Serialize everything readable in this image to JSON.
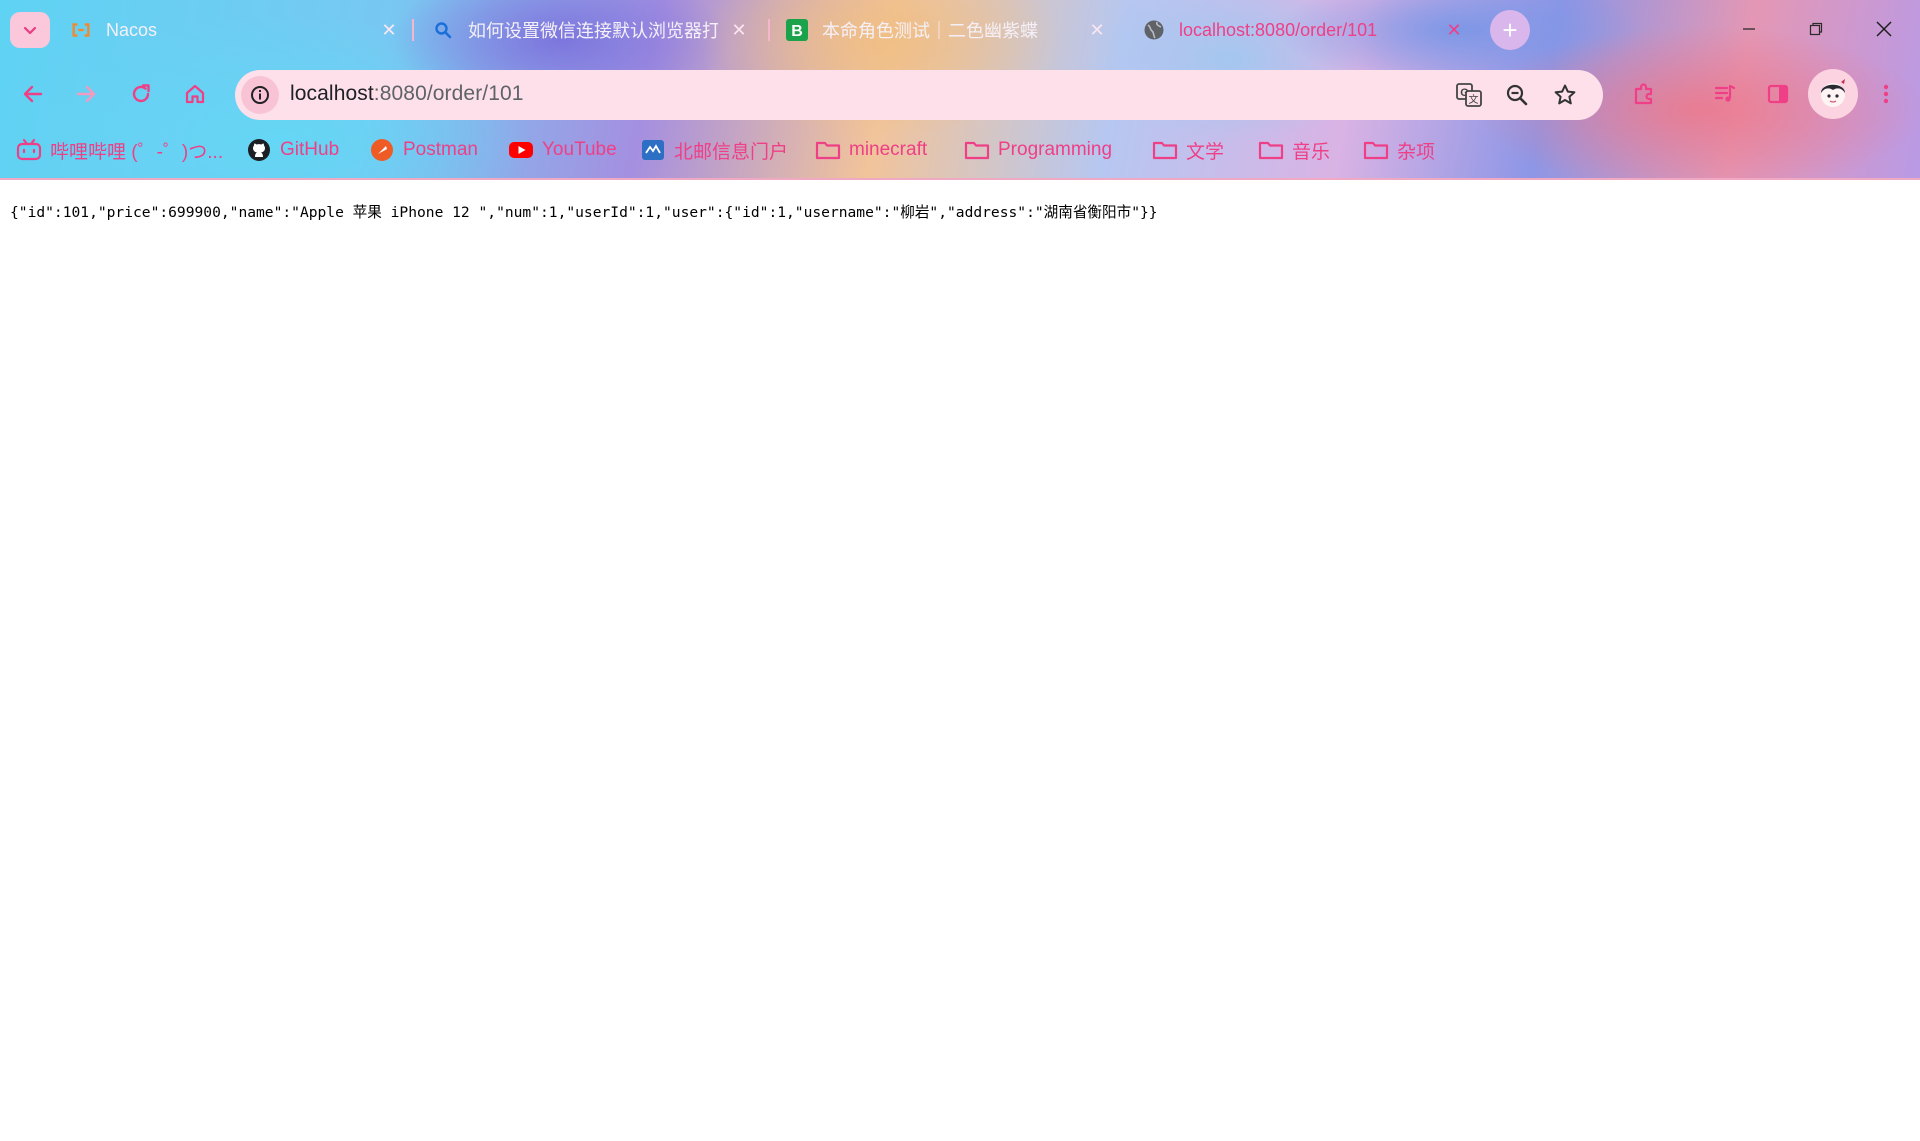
{
  "tabs": [
    {
      "title": "Nacos",
      "favicon": "nacos-icon",
      "active": false
    },
    {
      "title": "如何设置微信连接默认浏览器打",
      "favicon": "search-icon",
      "active": false
    },
    {
      "title": "本命角色测试｜二色幽紫蝶",
      "favicon": "b-letter-icon",
      "active": false
    },
    {
      "title": "localhost:8080/order/101",
      "favicon": "globe-icon",
      "active": true
    }
  ],
  "address_bar": {
    "host": "localhost",
    "path": ":8080/order/101"
  },
  "bookmarks": [
    {
      "label": "哔哩哔哩 (゜-゜)つ...",
      "icon": "bilibili-icon"
    },
    {
      "label": "GitHub",
      "icon": "github-icon"
    },
    {
      "label": "Postman",
      "icon": "postman-icon"
    },
    {
      "label": "YouTube",
      "icon": "youtube-icon"
    },
    {
      "label": "北邮信息门户",
      "icon": "bupt-icon"
    },
    {
      "label": "minecraft",
      "icon": "folder-icon"
    },
    {
      "label": "Programming",
      "icon": "folder-icon"
    },
    {
      "label": "文学",
      "icon": "folder-icon"
    },
    {
      "label": "音乐",
      "icon": "folder-icon"
    },
    {
      "label": "杂项",
      "icon": "folder-icon"
    }
  ],
  "page": {
    "json_text": "{\"id\":101,\"price\":699900,\"name\":\"Apple 苹果 iPhone 12 \",\"num\":1,\"userId\":1,\"user\":{\"id\":1,\"username\":\"柳岩\",\"address\":\"湖南省衡阳市\"}}"
  },
  "colors": {
    "accent_pink": "#ef3f86",
    "omnibox_bg": "#fde0ea"
  }
}
